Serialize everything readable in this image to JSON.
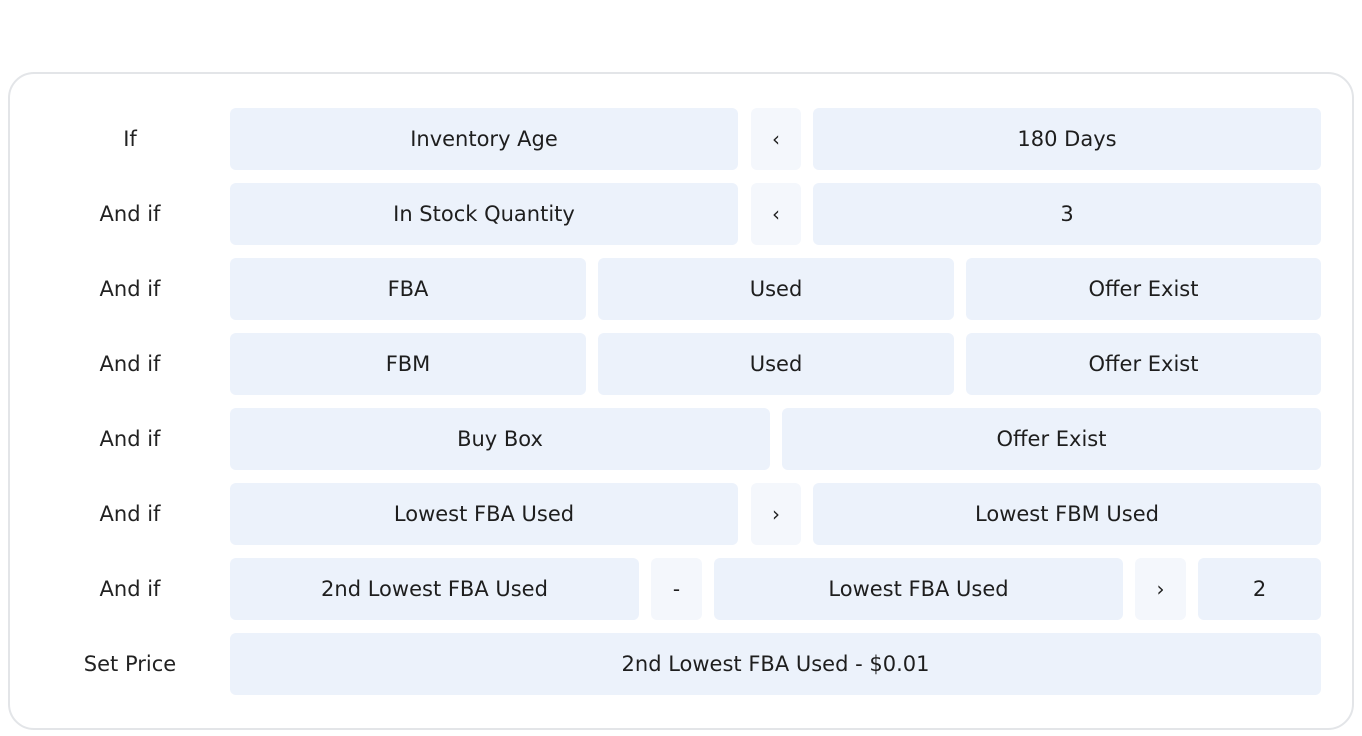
{
  "rules": [
    {
      "label": "If",
      "cells": [
        "Inventory Age",
        "‹",
        "180 Days"
      ]
    },
    {
      "label": "And if",
      "cells": [
        "In Stock Quantity",
        "‹",
        "3"
      ]
    },
    {
      "label": "And if",
      "cells": [
        "FBA",
        "Used",
        "Offer Exist"
      ]
    },
    {
      "label": "And if",
      "cells": [
        "FBM",
        "Used",
        "Offer Exist"
      ]
    },
    {
      "label": "And if",
      "cells": [
        "Buy Box",
        "Offer Exist"
      ]
    },
    {
      "label": "And if",
      "cells": [
        "Lowest FBA Used",
        "›",
        "Lowest FBM Used"
      ]
    },
    {
      "label": "And if",
      "cells": [
        "2nd Lowest FBA Used",
        "-",
        "Lowest FBA Used",
        "›",
        "2"
      ]
    },
    {
      "label": "Set Price",
      "cells": [
        "2nd Lowest FBA Used - $0.01"
      ]
    }
  ]
}
